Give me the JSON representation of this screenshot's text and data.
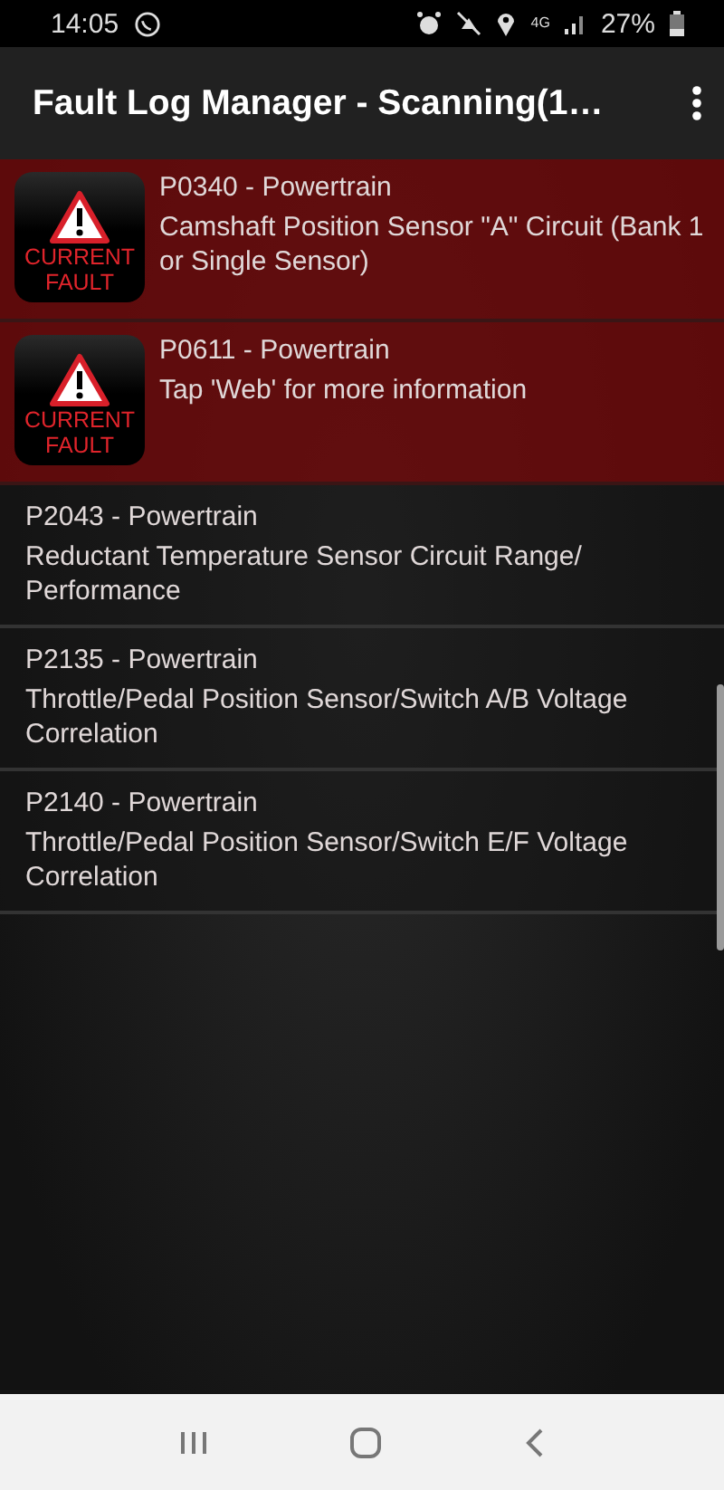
{
  "status_bar": {
    "time": "14:05",
    "network": "4G",
    "battery": "27%"
  },
  "app_bar": {
    "title": "Fault Log Manager - Scanning(1…"
  },
  "faults": [
    {
      "code": "P0340 - Powertrain",
      "description": "Camshaft Position Sensor \"A\" Circuit (Bank 1 or Single Sensor)",
      "current": true,
      "badge": [
        "CURRENT",
        "FAULT"
      ]
    },
    {
      "code": "P0611 - Powertrain",
      "description": "Tap 'Web' for more information",
      "current": true,
      "badge": [
        "CURRENT",
        "FAULT"
      ]
    },
    {
      "code": "P2043 - Powertrain",
      "description": "Reductant Temperature Sensor Circuit Range/ Performance",
      "current": false
    },
    {
      "code": "P2135 - Powertrain",
      "description": "Throttle/Pedal Position Sensor/Switch A/B Voltage Correlation",
      "current": false
    },
    {
      "code": "P2140 - Powertrain",
      "description": "Throttle/Pedal Position Sensor/Switch E/F Voltage Correlation",
      "current": false
    }
  ]
}
